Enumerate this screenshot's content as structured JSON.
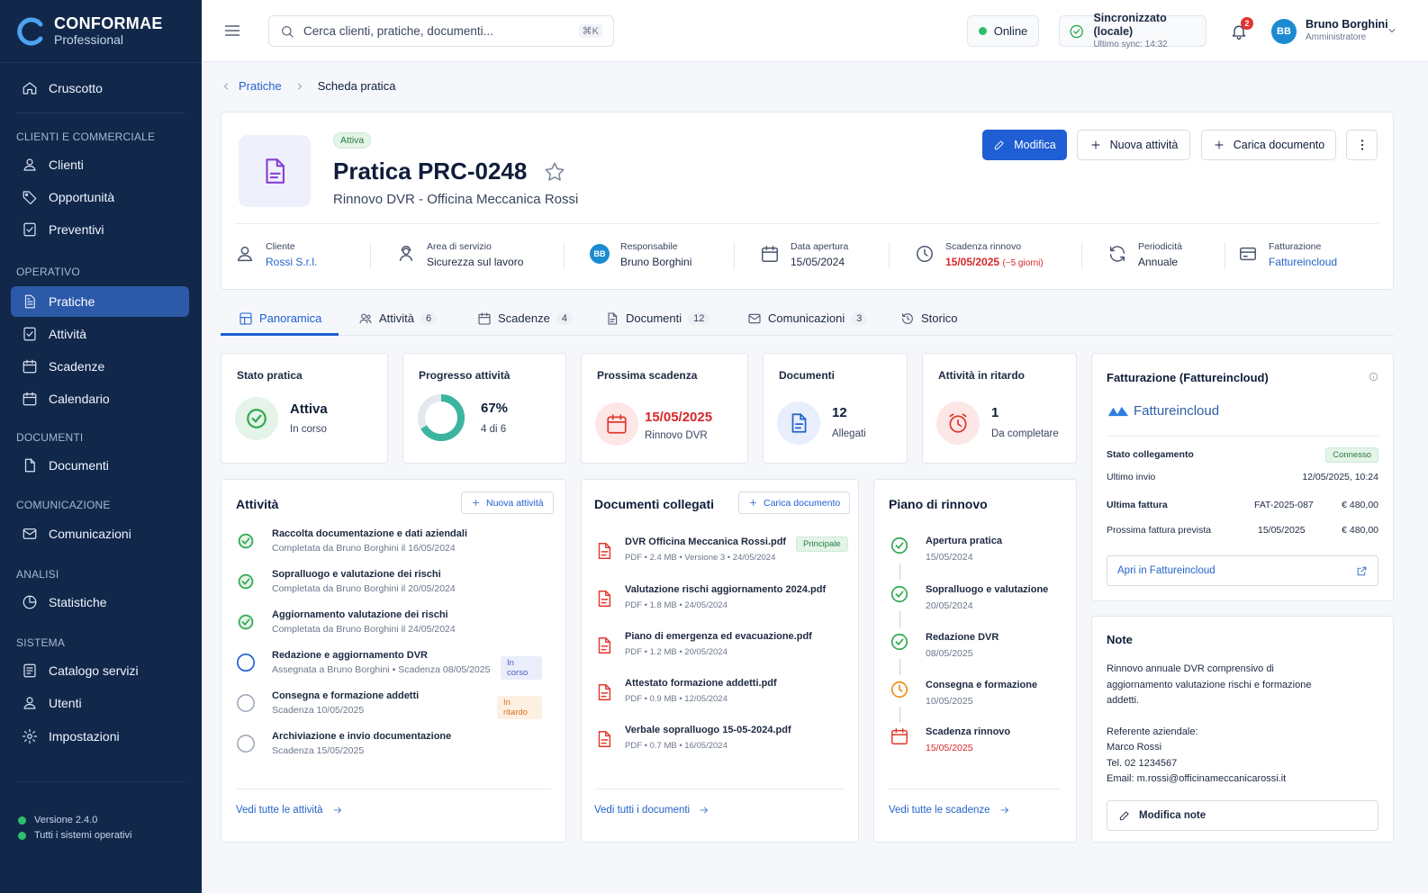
{
  "brand": {
    "name": "CONFORMAE",
    "edition": "Professional"
  },
  "sidebar": {
    "items": [
      {
        "label": "Cruscotto",
        "icon": "home-icon"
      },
      {
        "label": "Clienti",
        "icon": "user-icon"
      },
      {
        "label": "Opportunità",
        "icon": "tag-icon"
      },
      {
        "label": "Preventivi",
        "icon": "checklist-icon"
      },
      {
        "label": "Pratiche",
        "icon": "file-icon"
      },
      {
        "label": "Attività",
        "icon": "checklist-icon"
      },
      {
        "label": "Scadenze",
        "icon": "calendar-icon"
      },
      {
        "label": "Calendario",
        "icon": "calendar-icon"
      },
      {
        "label": "Documenti",
        "icon": "document-icon"
      },
      {
        "label": "Comunicazioni",
        "icon": "mail-icon"
      },
      {
        "label": "Statistiche",
        "icon": "chart-icon"
      },
      {
        "label": "Catalogo servizi",
        "icon": "book-icon"
      },
      {
        "label": "Utenti",
        "icon": "users-icon"
      },
      {
        "label": "Impostazioni",
        "icon": "gear-icon"
      }
    ],
    "sections": [
      "CLIENTI E COMMERCIALE",
      "OPERATIVO",
      "DOCUMENTI",
      "COMUNICAZIONE",
      "ANALISI",
      "SISTEMA"
    ],
    "footer": {
      "version": "Versione 2.4.0",
      "status": "Tutti i sistemi operativi"
    }
  },
  "topbar": {
    "search_placeholder": "Cerca clienti, pratiche, documenti...",
    "shortcut": "⌘K",
    "online": "Online",
    "sync_title": "Sincronizzato (locale)",
    "sync_sub": "Ultimo sync: 14:32",
    "notifications": "2",
    "user_initials": "BB",
    "user_name": "Bruno Borghini",
    "user_role": "Amministratore"
  },
  "breadcrumb": {
    "parent": "Pratiche",
    "current": "Scheda pratica"
  },
  "header": {
    "status": "Attiva",
    "title": "Pratica PRC-0248",
    "subtitle": "Rinnovo DVR - Officina Meccanica Rossi",
    "buttons": {
      "edit": "Modifica",
      "new_activity": "Nuova attività",
      "upload": "Carica documento"
    },
    "meta": {
      "client_label": "Cliente",
      "client": "Rossi S.r.l.",
      "area_label": "Area di servizio",
      "area": "Sicurezza sul lavoro",
      "owner_label": "Responsabile",
      "owner": "Bruno Borghini",
      "owner_initials": "BB",
      "opened_label": "Data apertura",
      "opened": "15/05/2024",
      "renewal_label": "Scadenza rinnovo",
      "renewal": "15/05/2025",
      "renewal_note": "(−5 giorni)",
      "period_label": "Periodicità",
      "period": "Annuale",
      "billing_label": "Fatturazione",
      "billing": "Fattureincloud"
    }
  },
  "tabs": [
    {
      "label": "Panoramica",
      "count": ""
    },
    {
      "label": "Attività",
      "count": "6"
    },
    {
      "label": "Scadenze",
      "count": "4"
    },
    {
      "label": "Documenti",
      "count": "12"
    },
    {
      "label": "Comunicazioni",
      "count": "3"
    },
    {
      "label": "Storico",
      "count": ""
    }
  ],
  "kpis": {
    "status": {
      "title": "Stato pratica",
      "value": "Attiva",
      "sub": "In corso"
    },
    "progress": {
      "title": "Progresso attività",
      "value": "67%",
      "sub": "4 di 6",
      "fraction": 0.67
    },
    "deadline": {
      "title": "Prossima scadenza",
      "value": "15/05/2025",
      "sub": "Rinnovo DVR"
    },
    "docs": {
      "title": "Documenti",
      "value": "12",
      "sub": "Allegati"
    },
    "late": {
      "title": "Attività in ritardo",
      "value": "1",
      "sub": "Da completare"
    }
  },
  "activities": {
    "title": "Attività",
    "add": "Nuova attività",
    "more": "Vedi tutte le attività",
    "items": [
      {
        "title": "Raccolta documentazione e dati aziendali",
        "sub": "Completata da Bruno Borghini il 16/05/2024",
        "state": "done",
        "pill": ""
      },
      {
        "title": "Sopralluogo e valutazione dei rischi",
        "sub": "Completata da Bruno Borghini il 20/05/2024",
        "state": "done",
        "pill": ""
      },
      {
        "title": "Aggiornamento valutazione dei rischi",
        "sub": "Completata da Bruno Borghini il 24/05/2024",
        "state": "done",
        "pill": ""
      },
      {
        "title": "Redazione e aggiornamento DVR",
        "sub": "Assegnata a Bruno Borghini • Scadenza 08/05/2025",
        "state": "progress",
        "pill": "In corso"
      },
      {
        "title": "Consegna e formazione addetti",
        "sub": "Scadenza 10/05/2025",
        "state": "todo",
        "pill": "In ritardo"
      },
      {
        "title": "Archiviazione e invio documentazione",
        "sub": "Scadenza 15/05/2025",
        "state": "todo",
        "pill": ""
      }
    ]
  },
  "documents": {
    "title": "Documenti collegati",
    "add": "Carica documento",
    "more": "Vedi tutti i documenti",
    "main_badge": "Principale",
    "items": [
      {
        "name": "DVR Officina Meccanica Rossi.pdf",
        "meta": "PDF  •  2.4 MB  •  Versione 3  •  24/05/2024"
      },
      {
        "name": "Valutazione rischi aggiornamento 2024.pdf",
        "meta": "PDF  •  1.8 MB  •  24/05/2024"
      },
      {
        "name": "Piano di emergenza ed evacuazione.pdf",
        "meta": "PDF  •  1.2 MB  •  20/05/2024"
      },
      {
        "name": "Attestato formazione addetti.pdf",
        "meta": "PDF  •  0.9 MB  •  12/05/2024"
      },
      {
        "name": "Verbale sopralluogo 15-05-2024.pdf",
        "meta": "PDF  •  0.7 MB  •  16/05/2024"
      }
    ]
  },
  "plan": {
    "title": "Piano di rinnovo",
    "more": "Vedi tutte le scadenze",
    "items": [
      {
        "title": "Apertura pratica",
        "date": "15/05/2024",
        "state": "done"
      },
      {
        "title": "Sopralluogo e valutazione",
        "date": "20/05/2024",
        "state": "done"
      },
      {
        "title": "Redazione DVR",
        "date": "08/05/2025",
        "state": "done"
      },
      {
        "title": "Consegna e formazione",
        "date": "10/05/2025",
        "state": "pending"
      },
      {
        "title": "Scadenza rinnovo",
        "date": "15/05/2025",
        "state": "deadline"
      }
    ]
  },
  "billing": {
    "title": "Fatturazione (Fattureincloud)",
    "brand": "Fattureincloud",
    "link_status_label": "Stato collegamento",
    "link_status": "Connesso",
    "last_send_label": "Ultimo invio",
    "last_send": "12/05/2025, 10:24",
    "last_invoice_label": "Ultima fattura",
    "last_invoice_no": "FAT-2025-087",
    "last_invoice_amount": "€ 480,00",
    "next_label": "Prossima fattura prevista",
    "next_date": "15/05/2025",
    "next_amount": "€ 480,00",
    "open": "Apri in Fattureincloud"
  },
  "notes": {
    "title": "Note",
    "line1": "Rinnovo annuale DVR comprensivo di",
    "line2": "aggiornamento valutazione rischi e formazione",
    "line3": "addetti.",
    "line4": "Referente aziendale:",
    "line5": "Marco Rossi",
    "line6": "Tel. 02 1234567",
    "line7": "Email: m.rossi@officinameccanicarossi.it",
    "edit": "Modifica note"
  },
  "colors": {
    "primary": "#1f5fd3",
    "sidebar": "#11284b",
    "success": "#2fa84f",
    "danger": "#d6282a",
    "warning": "#f08c1c"
  }
}
